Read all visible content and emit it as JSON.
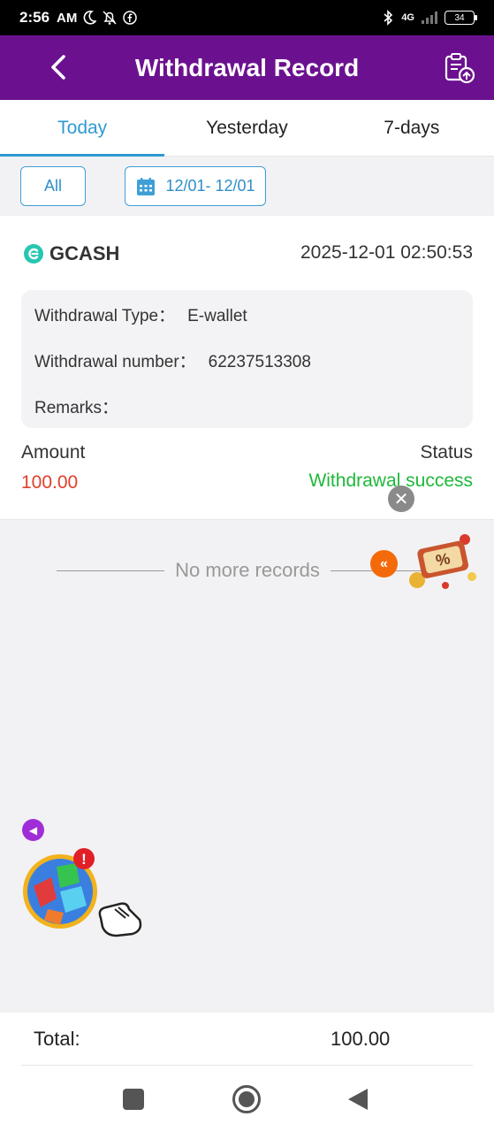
{
  "status_bar": {
    "time": "2:56",
    "ampm": "AM",
    "network": "4G",
    "battery": "34"
  },
  "header": {
    "title": "Withdrawal Record"
  },
  "tabs": [
    {
      "label": "Today",
      "active": true
    },
    {
      "label": "Yesterday",
      "active": false
    },
    {
      "label": "7-days",
      "active": false
    }
  ],
  "filters": {
    "all_label": "All",
    "date_range": "12/01- 12/01"
  },
  "record": {
    "method": "GCASH",
    "datetime": "2025-12-01 02:50:53",
    "type_label": "Withdrawal Type：",
    "type_value": "E-wallet",
    "number_label": "Withdrawal number：",
    "number_value": "62237513308",
    "remarks_label": "Remarks：",
    "remarks_value": "",
    "amount_label": "Amount",
    "amount_value": "100.00",
    "status_label": "Status",
    "status_value": "Withdrawal success"
  },
  "list_end": "No more records",
  "total": {
    "label": "Total:",
    "value": "100.00"
  },
  "colors": {
    "header": "#6b118f",
    "accent": "#2f9ad3",
    "amount": "#e0402c",
    "success": "#1fb83a"
  },
  "icons": [
    "back-arrow-icon",
    "upload-record-icon",
    "calendar-icon",
    "gcash-icon",
    "close-icon",
    "double-chevron-left-icon",
    "caret-left-icon",
    "recents-square-icon",
    "home-circle-icon",
    "back-triangle-icon"
  ]
}
